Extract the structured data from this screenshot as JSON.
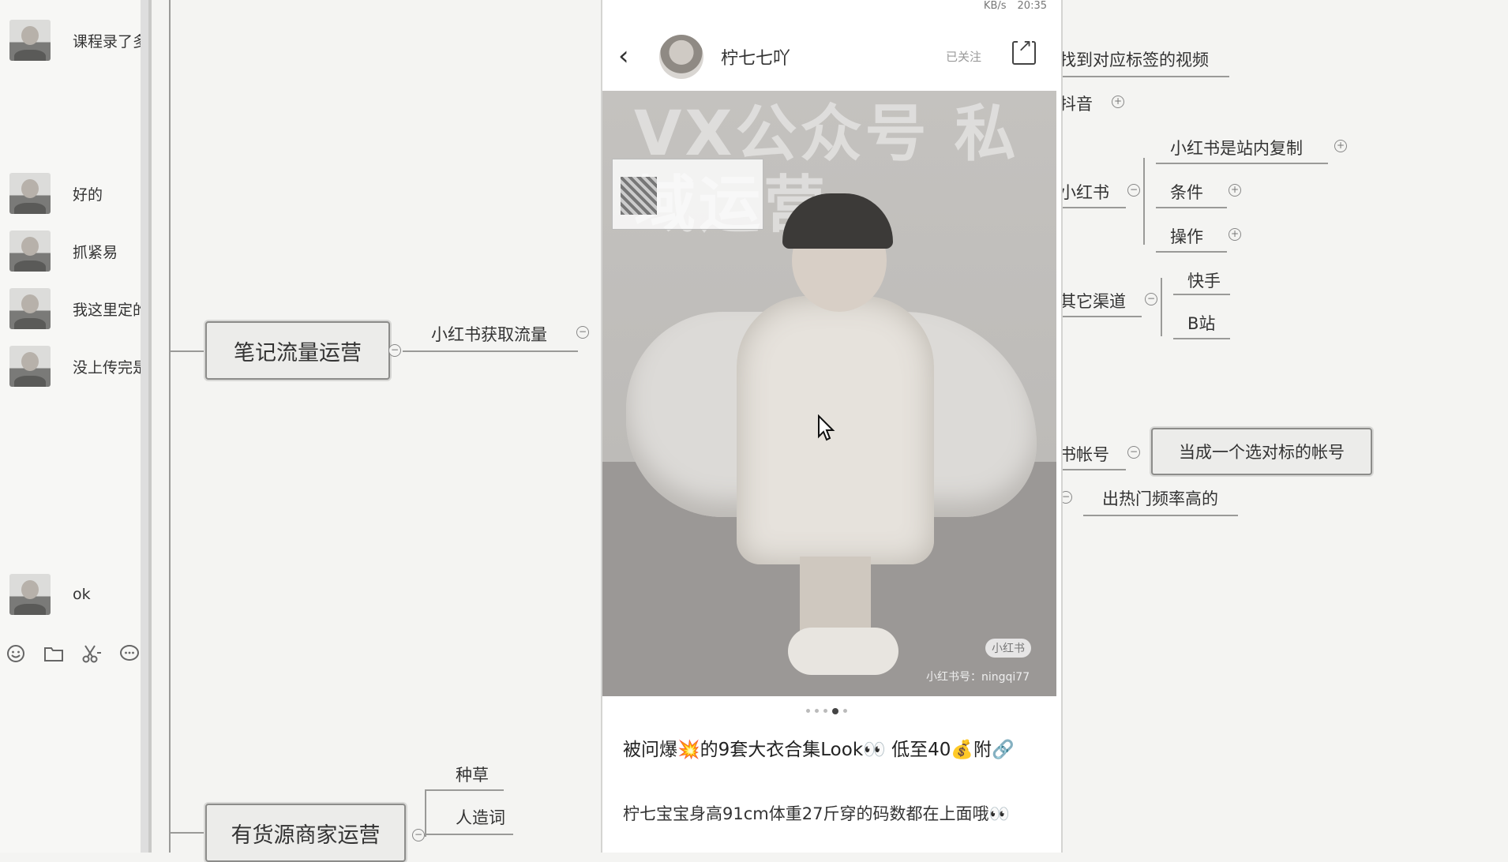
{
  "chat": {
    "messages": [
      {
        "text": "课程录了多"
      },
      {
        "text": "好的"
      },
      {
        "text": "抓紧易"
      },
      {
        "text": "我这里定的"
      },
      {
        "text": "没上传完是"
      },
      {
        "text": "ok"
      }
    ],
    "tools": [
      "smile-icon",
      "folder-icon",
      "scissors-icon",
      "chat-bubble-icon"
    ]
  },
  "mindmap": {
    "topic_notes": "笔记流量运营",
    "topic_notes_child": "小红书获取流量",
    "topic_merchant": "有货源商家运营",
    "merchant_children": [
      "种草",
      "人造词"
    ],
    "right": {
      "find_tag_videos": "找到对应标签的视频",
      "douyin": "抖音",
      "xiaohongshu": "小红书",
      "xhs_children": [
        "小红书是站内复制",
        "条件",
        "操作"
      ],
      "other_channels": "其它渠道",
      "other_children": [
        "快手",
        "B站"
      ],
      "account": "书帐号",
      "account_child": "当成一个选对标的帐号",
      "hot_freq": "出热门频率高的"
    }
  },
  "phone": {
    "status": {
      "net": "KB/s",
      "time": "20:35"
    },
    "author": "柠七七吖",
    "follow_label": "已关注",
    "watermark": "VX公众号 私域运营",
    "brand_badge": "小红书",
    "user_id": "小红书号：ningqi77",
    "note_title": "被问爆💥的9套大衣合集Look👀 低至40💰附🔗",
    "note_body": "柠七宝宝身高91cm体重27斤穿的码数都在上面哦👀"
  },
  "colors": {
    "page_bg": "#f4f4f2",
    "phone_bg": "#ffffff",
    "topic_border": "#8c8c8a"
  }
}
